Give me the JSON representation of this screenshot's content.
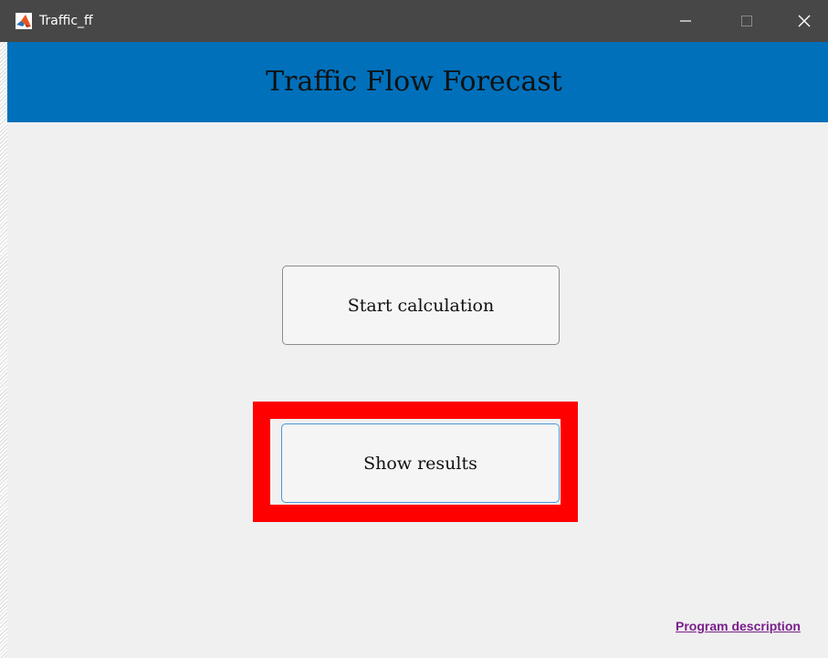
{
  "window": {
    "title": "Traffic_ff",
    "app_icon": "matlab-logo-icon",
    "controls": {
      "minimize": "minimize-icon",
      "maximize": "maximize-icon",
      "close": "close-icon"
    }
  },
  "header": {
    "title": "Traffic Flow Forecast",
    "background_color": "#0070bb"
  },
  "main": {
    "start_button_label": "Start calculation",
    "show_results_label": "Show results",
    "highlight_color": "#ff0000"
  },
  "footer": {
    "link_label": "Program description"
  }
}
